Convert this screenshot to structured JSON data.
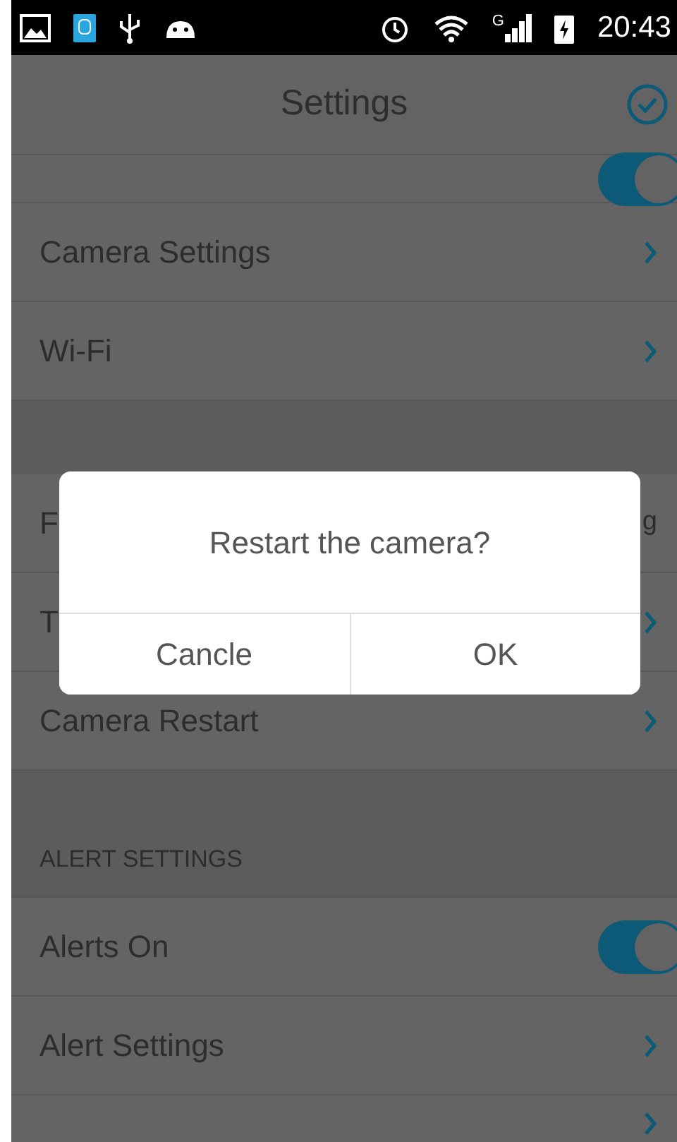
{
  "status_bar": {
    "network_type": "G",
    "time": "20:43"
  },
  "header": {
    "title": "Settings"
  },
  "sections": [
    {
      "rows": [
        {
          "kind": "toggle",
          "on": true
        },
        {
          "kind": "link",
          "label": "Camera Settings"
        },
        {
          "kind": "link",
          "label": "Wi-Fi"
        }
      ]
    },
    {
      "rows": [
        {
          "kind": "value",
          "label": "F",
          "value": "g"
        },
        {
          "kind": "link",
          "label": "T"
        },
        {
          "kind": "link",
          "label": "Camera Restart"
        }
      ]
    },
    {
      "heading": "ALERT SETTINGS",
      "rows": [
        {
          "kind": "toggle",
          "label": "Alerts On",
          "on": true
        },
        {
          "kind": "link",
          "label": "Alert Settings"
        },
        {
          "kind": "link"
        }
      ]
    }
  ],
  "dialog": {
    "message": "Restart the camera?",
    "buttons": [
      "Cancle",
      "OK"
    ]
  }
}
